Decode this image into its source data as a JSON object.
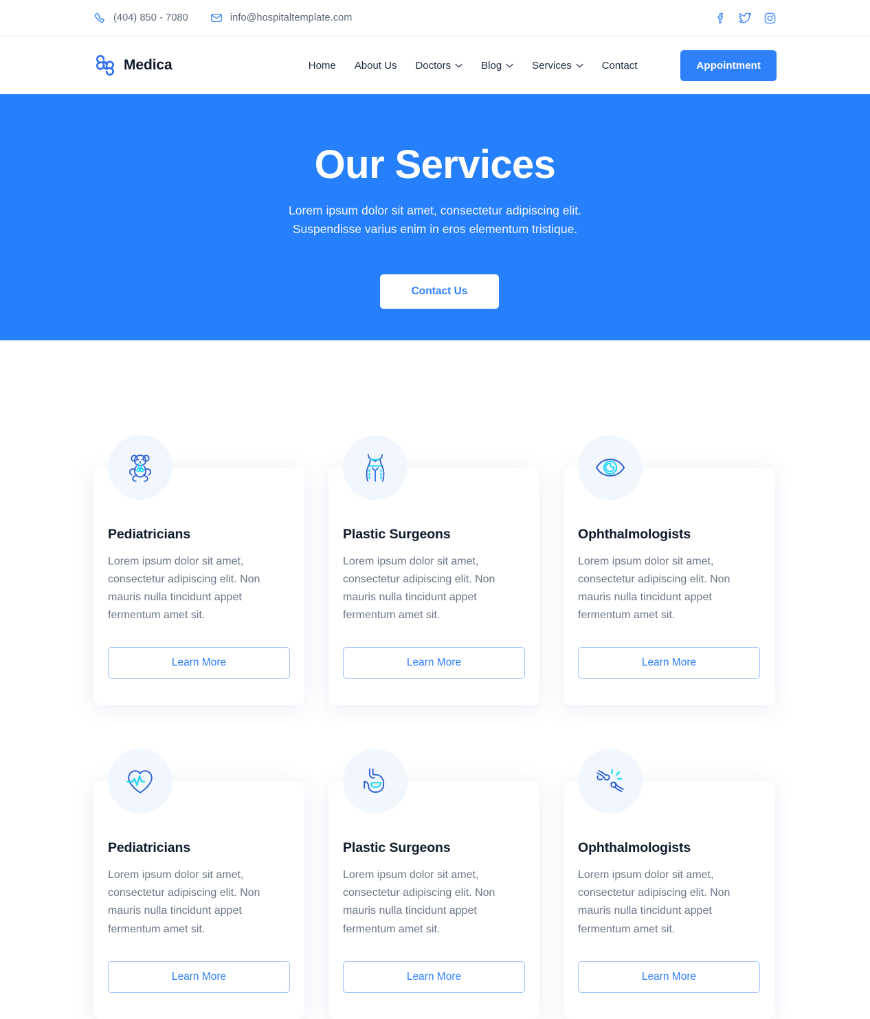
{
  "topbar": {
    "phone": {
      "icon": "phone-icon",
      "text": "(404) 850 - 7080"
    },
    "email": {
      "icon": "mail-icon",
      "text": "info@hospitaltemplate.com"
    },
    "social": [
      {
        "name": "facebook-icon",
        "label": "Facebook"
      },
      {
        "name": "twitter-icon",
        "label": "Twitter"
      },
      {
        "name": "instagram-icon",
        "label": "Instagram"
      }
    ]
  },
  "header": {
    "brand": {
      "name": "Medica",
      "logo_icon": "medical-cross-logo-icon"
    },
    "nav": [
      {
        "label": "Home",
        "has_dropdown": false
      },
      {
        "label": "About Us",
        "has_dropdown": false
      },
      {
        "label": "Doctors",
        "has_dropdown": true
      },
      {
        "label": "Blog",
        "has_dropdown": true
      },
      {
        "label": "Services",
        "has_dropdown": true
      },
      {
        "label": "Contact",
        "has_dropdown": false
      }
    ],
    "appointment_button": "Appointment"
  },
  "hero": {
    "title": "Our Services",
    "subtitle": "Lorem ipsum dolor sit amet, consectetur adipiscing elit. Suspendisse varius enim in eros elementum tristique.",
    "subtitle_line1": "Lorem ipsum dolor sit amet, consectetur adipiscing elit.",
    "subtitle_line2": "Suspendisse varius enim in eros elementum tristique.",
    "cta_label": "Contact Us"
  },
  "services": {
    "body_text": "Lorem ipsum dolor sit amet, consectetur adipiscing elit. Non mauris nulla tincidunt  appet fermentum amet sit.",
    "learn_more_label": "Learn More",
    "cards": [
      {
        "title": "Pediatricians",
        "icon": "teddy-bear-icon",
        "description": "Lorem ipsum dolor sit amet, consectetur adipiscing elit. Non mauris nulla tincidunt  appet fermentum amet sit.",
        "cta": "Learn More"
      },
      {
        "title": "Plastic Surgeons",
        "icon": "torso-icon",
        "description": "Lorem ipsum dolor sit amet, consectetur adipiscing elit. Non mauris nulla tincidunt  appet fermentum amet sit.",
        "cta": "Learn More"
      },
      {
        "title": "Ophthalmologists",
        "icon": "eye-icon",
        "description": "Lorem ipsum dolor sit amet, consectetur adipiscing elit. Non mauris nulla tincidunt  appet fermentum amet sit.",
        "cta": "Learn More"
      },
      {
        "title": "Pediatricians",
        "icon": "heart-pulse-icon",
        "description": "Lorem ipsum dolor sit amet, consectetur adipiscing elit. Non mauris nulla tincidunt  appet fermentum amet sit.",
        "cta": "Learn More"
      },
      {
        "title": "Plastic Surgeons",
        "icon": "stomach-icon",
        "description": "Lorem ipsum dolor sit amet, consectetur adipiscing elit. Non mauris nulla tincidunt  appet fermentum amet sit.",
        "cta": "Learn More"
      },
      {
        "title": "Ophthalmologists",
        "icon": "bone-joint-icon",
        "description": "Lorem ipsum dolor sit amet, consectetur adipiscing elit. Non mauris nulla tincidunt  appet fermentum amet sit.",
        "cta": "Learn More"
      }
    ]
  },
  "colors": {
    "brand_blue": "#2f80fb",
    "hero_blue": "#2680fb",
    "icon_dark_blue": "#2f5fd0",
    "icon_cyan": "#18d6f7",
    "heading_dark": "#111a2c",
    "body_gray": "#6b7687",
    "icon_circle_bg": "#f2f7fe"
  }
}
